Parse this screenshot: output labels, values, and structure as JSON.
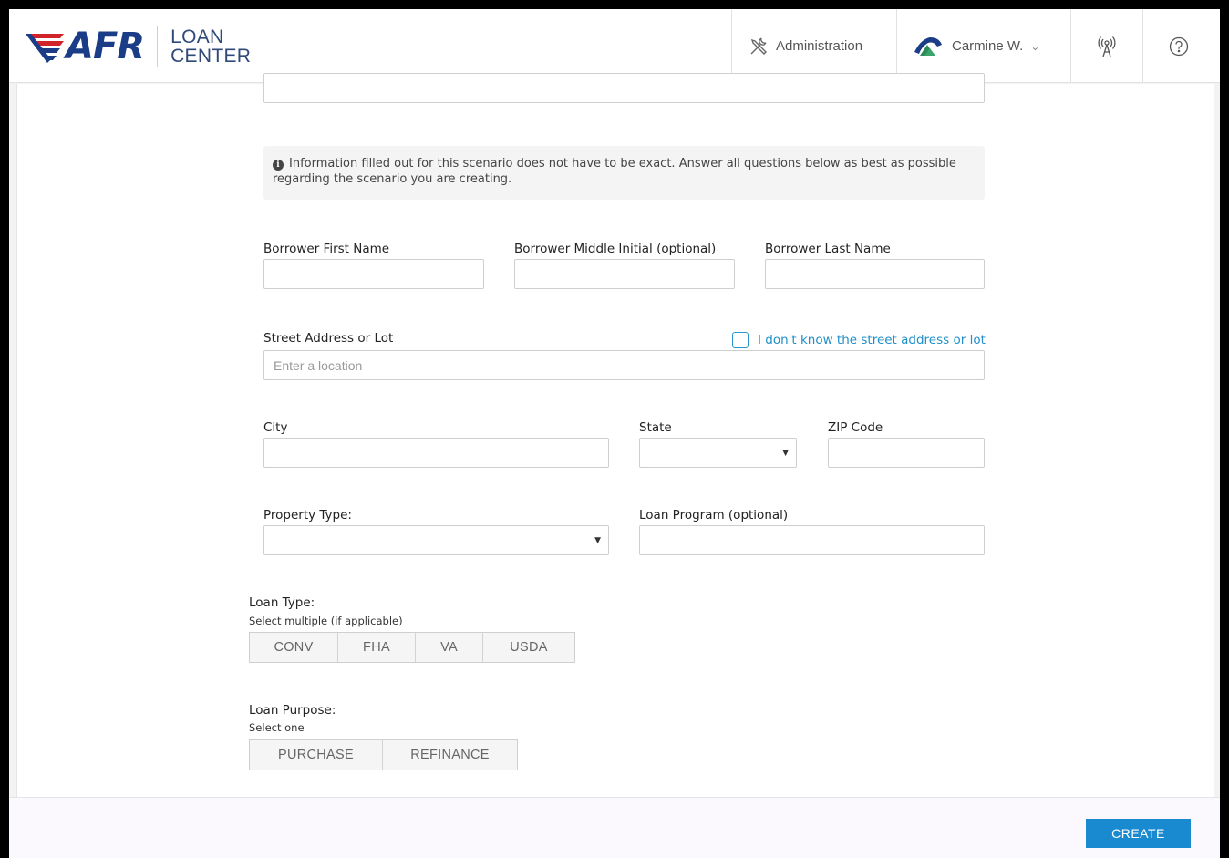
{
  "brand": {
    "logo_text": "AFR",
    "line1": "LOAN",
    "line2": "CENTER"
  },
  "header": {
    "admin_label": "Administration",
    "user_name": "Carmine W."
  },
  "info_text": "Information filled out for this scenario does not have to be exact. Answer all questions below as best as possible regarding the scenario you are creating.",
  "fields": {
    "first_name_label": "Borrower First Name",
    "middle_initial_label": "Borrower Middle Initial (optional)",
    "last_name_label": "Borrower Last Name",
    "street_label": "Street Address or Lot",
    "street_placeholder": "Enter a location",
    "unknown_address_label": "I don't know the street address or lot",
    "city_label": "City",
    "state_label": "State",
    "zip_label": "ZIP Code",
    "property_type_label": "Property Type:",
    "loan_program_label": "Loan Program (optional)"
  },
  "loan_type": {
    "label": "Loan Type:",
    "hint": "Select multiple (if applicable)",
    "options": [
      "CONV",
      "FHA",
      "VA",
      "USDA"
    ]
  },
  "loan_purpose": {
    "label": "Loan Purpose:",
    "hint": "Select one",
    "options": [
      "PURCHASE",
      "REFINANCE"
    ]
  },
  "actions": {
    "create_label": "CREATE"
  },
  "colors": {
    "brand_navy": "#1b3c86",
    "brand_red": "#d2232a",
    "accent_blue": "#1a8ad0"
  }
}
